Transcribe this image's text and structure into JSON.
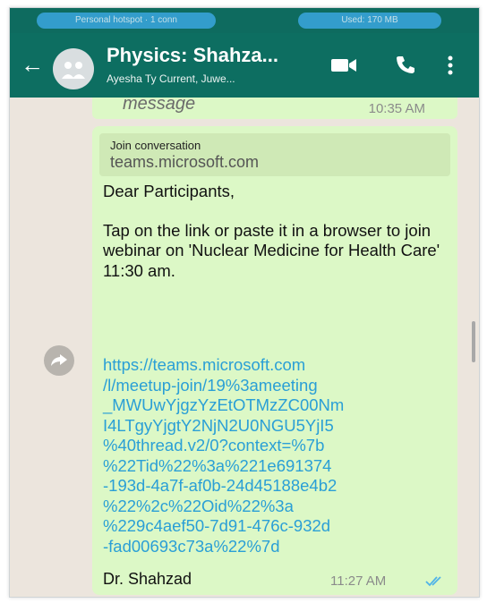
{
  "status_bar": {
    "left_pill": "Personal hotspot · 1 conn",
    "right_pill": "Used: 170 MB"
  },
  "header": {
    "title": "Physics: Shahza...",
    "subtitle": "Ayesha Ty Current, Juwe..."
  },
  "previous_message": {
    "text": "message",
    "time": "10:35 AM"
  },
  "message": {
    "link_preview_title": "Join conversation",
    "link_preview_domain": "teams.microsoft.com",
    "paragraphs": [
      "Dear Participants,",
      "Tap on the link or paste it in a browser to join webinar on 'Nuclear Medicine for Health Care' 11:30 am."
    ],
    "link_lines": [
      "https://teams.microsoft.com",
      "/l/meetup-join/19%3ameeting",
      "_MWUwYjgzYzEtOTMzZC00Nm",
      "I4LTgyYjgtY2NjN2U0NGU5YjI5",
      "%40thread.v2/0?context=%7b",
      "%22Tid%22%3a%221e691374",
      "-193d-4a7f-af0b-24d45188e4b2",
      "%22%2c%22Oid%22%3a",
      "%229c4aef50-7d91-476c-932d",
      "-fad00693c73a%22%7d"
    ],
    "signature": "Dr. Shahzad",
    "time": "11:27 AM"
  },
  "colors": {
    "header": "#0d6e61",
    "bubble": "#dcf8c6",
    "link": "#2a9fd6",
    "chat_background": "#ece5dd"
  },
  "icons": [
    "back-arrow-icon",
    "avatar-icon",
    "video-call-icon",
    "phone-icon",
    "more-options-icon",
    "share-icon",
    "read-ticks-icon"
  ]
}
